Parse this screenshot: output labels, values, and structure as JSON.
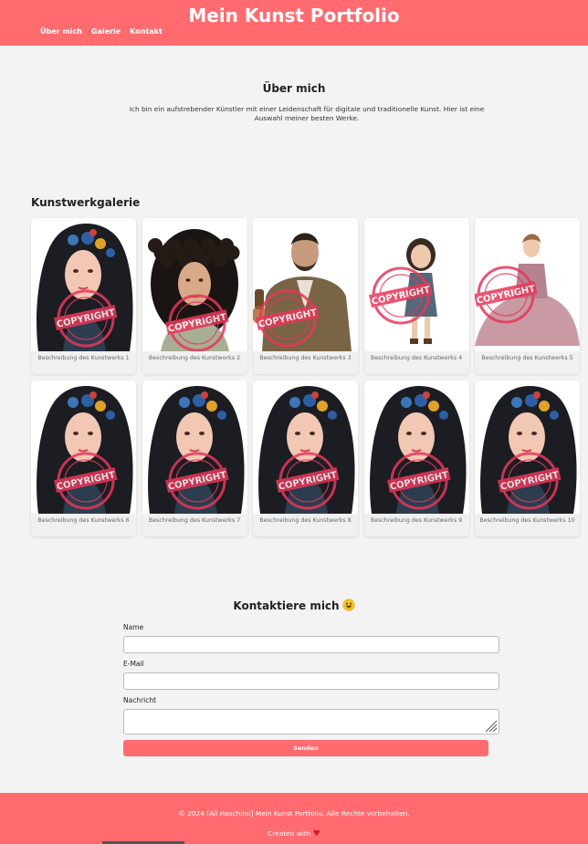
{
  "header": {
    "title": "Mein Kunst Portfolio",
    "nav": [
      "Über mich",
      "Galerie",
      "Kontakt"
    ],
    "bg_color": "#ff6b6f"
  },
  "about": {
    "title": "Über mich",
    "text": "Ich bin ein aufstrebender Künstler mit einer Leidenschaft für digitale und traditionelle Kunst. Hier ist eine Auswahl meiner besten Werke."
  },
  "gallery": {
    "title": "Kunstwerkgalerie",
    "items": [
      {
        "caption": "Beschreibung des Kunstwerks 1",
        "subject": "flower-crown-woman"
      },
      {
        "caption": "Beschreibung des Kunstwerks 2",
        "subject": "curly-hair-woman"
      },
      {
        "caption": "Beschreibung des Kunstwerks 3",
        "subject": "bearded-man-suit"
      },
      {
        "caption": "Beschreibung des Kunstwerks 4",
        "subject": "little-girl"
      },
      {
        "caption": "Beschreibung des Kunstwerks 5",
        "subject": "woman-in-gown"
      },
      {
        "caption": "Beschreibung des Kunstwerks 6",
        "subject": "flower-crown-woman"
      },
      {
        "caption": "Beschreibung des Kunstwerks 7",
        "subject": "flower-crown-woman"
      },
      {
        "caption": "Beschreibung des Kunstwerks 8",
        "subject": "flower-crown-woman"
      },
      {
        "caption": "Beschreibung des Kunstwerks 9",
        "subject": "flower-crown-woman"
      },
      {
        "caption": "Beschreibung des Kunstwerks 10",
        "subject": "flower-crown-woman"
      }
    ],
    "watermark": "COPYRIGHT",
    "watermark_color": "#e8375a"
  },
  "contact": {
    "title": "Kontaktiere mich",
    "title_icon": "grinning-face-emoji",
    "name_label": "Name",
    "email_label": "E-Mail",
    "message_label": "Nachricht",
    "submit_label": "Senden"
  },
  "footer": {
    "copyright": "© 2024 [Ali Haschimi] Mein Kunst Portfolio. Alle Rechte vorbehalten.",
    "created_with": "Created with",
    "heart": "♥"
  }
}
